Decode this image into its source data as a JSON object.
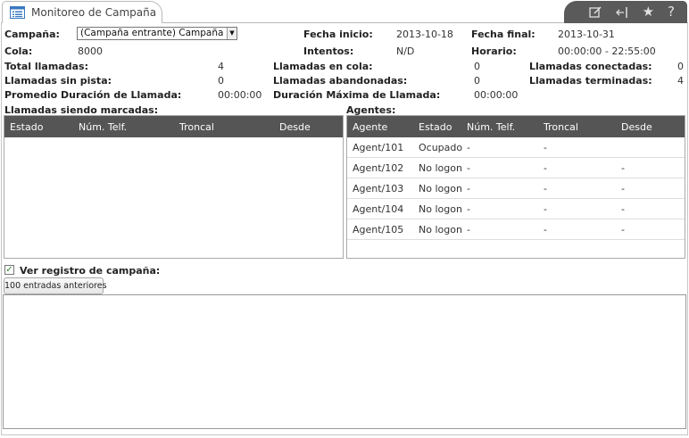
{
  "header": {
    "tab_title": "Monitoreo de Campaña",
    "icons": [
      "edit-icon",
      "collapse-left-icon",
      "star-icon",
      "help-icon"
    ]
  },
  "info": {
    "campaign_label": "Campaña:",
    "campaign_value": "(Campaña entrante) Campaña A",
    "start_label": "Fecha inicio:",
    "start_value": "2013-10-18",
    "end_label": "Fecha final:",
    "end_value": "2013-10-31",
    "queue_label": "Cola:",
    "queue_value": "8000",
    "attempts_label": "Intentos:",
    "attempts_value": "N/D",
    "schedule_label": "Horario:",
    "schedule_value": "00:00:00 - 22:55:00",
    "total_calls_label": "Total llamadas:",
    "total_calls_value": "4",
    "queued_label": "Llamadas en cola:",
    "queued_value": "0",
    "connected_label": "Llamadas conectadas:",
    "connected_value": "0",
    "no_track_label": "Llamadas sin pista:",
    "no_track_value": "0",
    "abandoned_label": "Llamadas abandonadas:",
    "abandoned_value": "0",
    "finished_label": "Llamadas terminadas:",
    "finished_value": "4",
    "avg_duration_label": "Promedio Duración de Llamada:",
    "avg_duration_value": "00:00:00",
    "max_duration_label": "Duración Máxima de Llamada:",
    "max_duration_value": "00:00:00"
  },
  "dialing": {
    "title": "Llamadas siendo marcadas:",
    "columns": [
      "Estado",
      "Núm. Telf.",
      "Troncal",
      "Desde"
    ],
    "rows": []
  },
  "agents": {
    "title": "Agentes:",
    "columns": [
      "Agente",
      "Estado",
      "Núm. Telf.",
      "Troncal",
      "Desde"
    ],
    "rows": [
      [
        "Agent/101",
        "Ocupado",
        "-",
        "-",
        ""
      ],
      [
        "Agent/102",
        "No logon",
        "-",
        "-",
        "-"
      ],
      [
        "Agent/103",
        "No logon",
        "-",
        "-",
        "-"
      ],
      [
        "Agent/104",
        "No logon",
        "-",
        "-",
        "-"
      ],
      [
        "Agent/105",
        "No logon",
        "-",
        "-",
        "-"
      ]
    ]
  },
  "log": {
    "checkbox_label": "Ver registro de campaña:",
    "checked": true,
    "prev_button": "100 entradas anteriores"
  }
}
